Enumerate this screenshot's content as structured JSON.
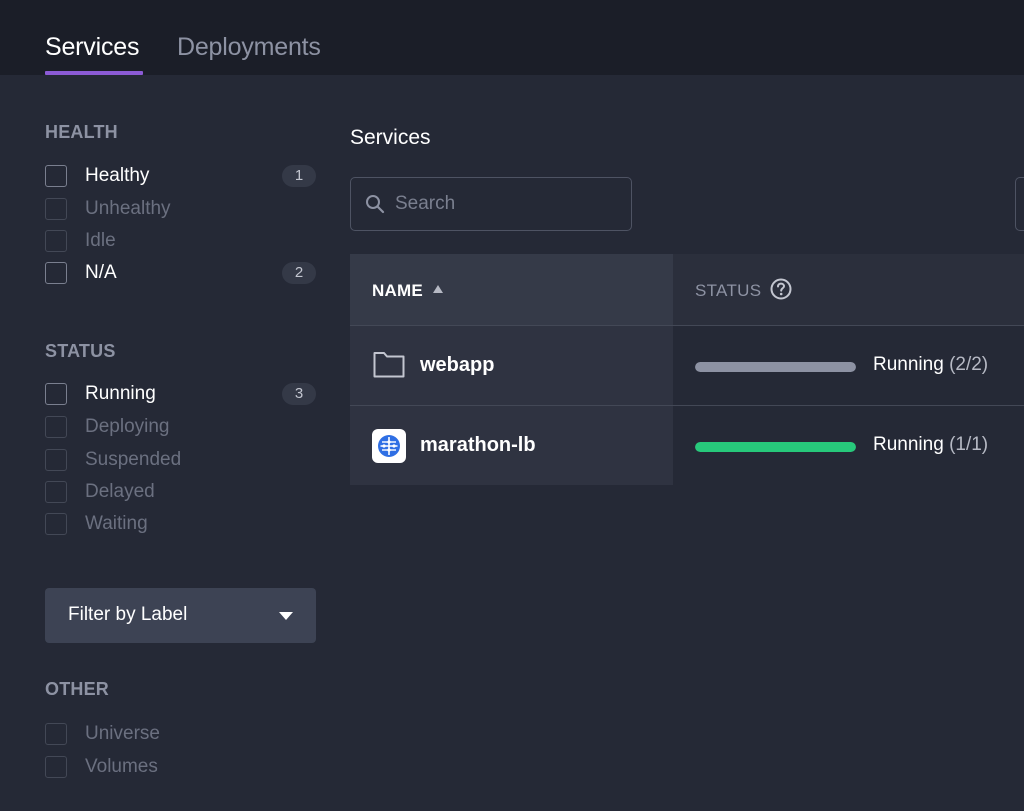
{
  "tabs": [
    {
      "label": "Services",
      "active": true
    },
    {
      "label": "Deployments",
      "active": false
    }
  ],
  "sidebar": {
    "health": {
      "title": "HEALTH",
      "items": [
        {
          "label": "Healthy",
          "count": "1",
          "enabled": true
        },
        {
          "label": "Unhealthy",
          "count": "",
          "enabled": false
        },
        {
          "label": "Idle",
          "count": "",
          "enabled": false
        },
        {
          "label": "N/A",
          "count": "2",
          "enabled": true
        }
      ]
    },
    "status": {
      "title": "STATUS",
      "items": [
        {
          "label": "Running",
          "count": "3",
          "enabled": true
        },
        {
          "label": "Deploying",
          "count": "",
          "enabled": false
        },
        {
          "label": "Suspended",
          "count": "",
          "enabled": false
        },
        {
          "label": "Delayed",
          "count": "",
          "enabled": false
        },
        {
          "label": "Waiting",
          "count": "",
          "enabled": false
        }
      ]
    },
    "filter_by_label": "Filter by Label",
    "other": {
      "title": "OTHER",
      "items": [
        {
          "label": "Universe",
          "enabled": false
        },
        {
          "label": "Volumes",
          "enabled": false
        }
      ]
    }
  },
  "main": {
    "title": "Services",
    "search": {
      "placeholder": "Search",
      "value": ""
    },
    "table": {
      "columns": {
        "name": "NAME",
        "status": "STATUS"
      },
      "rows": [
        {
          "icon": "folder-icon",
          "name": "webapp",
          "status": "Running",
          "count": "(2/2)",
          "progress": 1.0,
          "bar_color": "#8d92a3"
        },
        {
          "icon": "marathon-lb-app-icon",
          "name": "marathon-lb",
          "status": "Running",
          "count": "(1/1)",
          "progress": 1.0,
          "bar_color": "#27c97b"
        }
      ]
    }
  },
  "colors": {
    "accent": "#8c5bd6",
    "background": "#252936",
    "healthy": "#27c97b"
  }
}
